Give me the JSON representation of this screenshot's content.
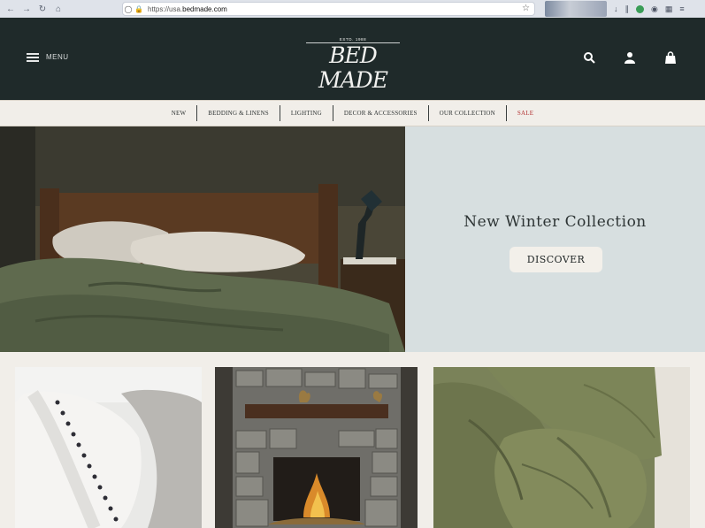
{
  "browser": {
    "url_prefix": "https://usa.",
    "url_domain": "bedmade.com"
  },
  "header": {
    "menu_label": "MENU",
    "logo_est": "ESTD. 1988",
    "logo_name": "BED MADE"
  },
  "nav": {
    "items": [
      "NEW",
      "BEDDING & LINENS",
      "LIGHTING",
      "DECOR & ACCESSORIES",
      "OUR COLLECTION",
      "SALE"
    ]
  },
  "hero": {
    "title": "New Winter Collection",
    "cta_label": "DISCOVER"
  },
  "colors": {
    "header_bg": "#1f2a2a",
    "page_bg": "#f1eee9",
    "hero_panel": "#d7dfe0",
    "sale": "#b23232"
  }
}
